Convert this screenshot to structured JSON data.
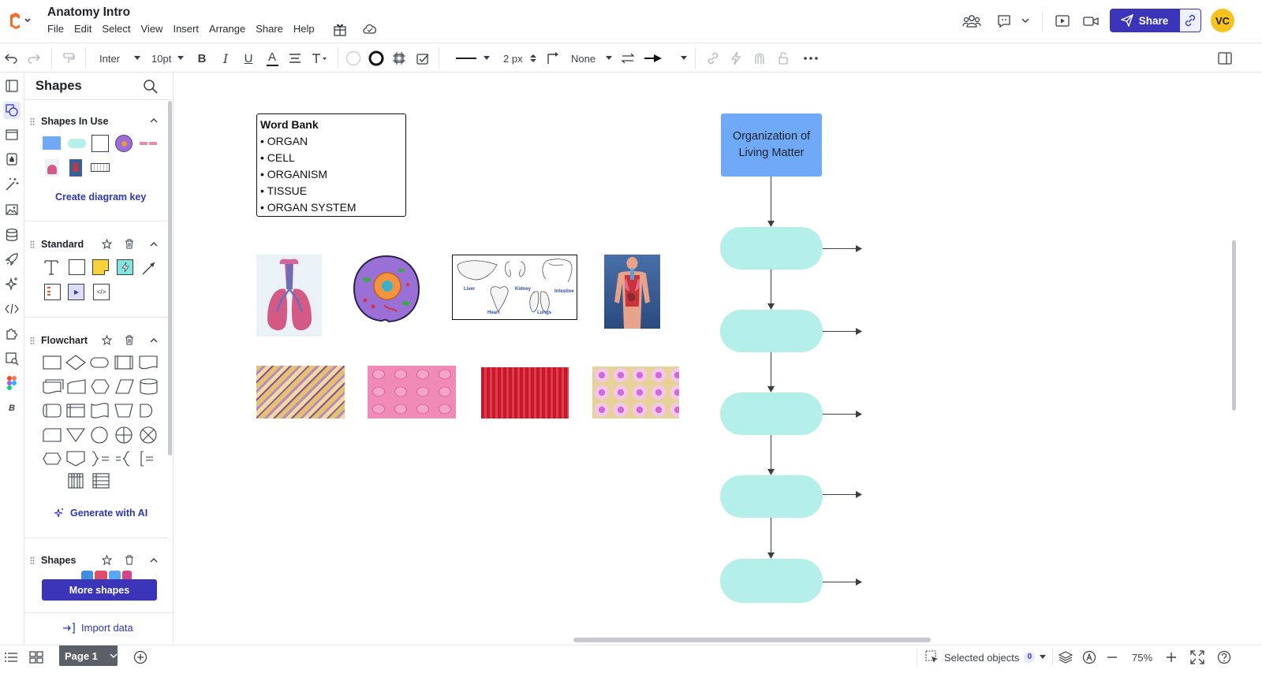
{
  "header": {
    "title": "Anatomy Intro",
    "menu": [
      "File",
      "Edit",
      "Select",
      "View",
      "Insert",
      "Arrange",
      "Share",
      "Help"
    ],
    "share_label": "Share",
    "avatar_initials": "VC"
  },
  "toolbar": {
    "font": "Inter",
    "font_size": "10pt",
    "line_width": "2 px",
    "arrow_start": "None"
  },
  "panel": {
    "title": "Shapes",
    "shapes_in_use": "Shapes In Use",
    "create_key": "Create diagram key",
    "standard": "Standard",
    "flowchart": "Flowchart",
    "generate_ai": "Generate with AI",
    "shapes_section": "Shapes",
    "more_shapes": "More shapes",
    "import_data": "Import data"
  },
  "canvas": {
    "word_bank": {
      "title": "Word Bank",
      "items": [
        "• ORGAN",
        "• CELL",
        "• ORGANISM",
        "• TISSUE",
        "• ORGAN SYSTEM"
      ]
    },
    "organ_labels": [
      "Liver",
      "Kidney",
      "Intestine",
      "Heart",
      "Lungs"
    ],
    "flow_title": "Organization of Living Matter"
  },
  "bottom": {
    "page_label": "Page 1",
    "selected_objects": "Selected objects",
    "selected_count": "0",
    "zoom": "75%"
  },
  "colors": {
    "accent": "#3a35b8",
    "flow_title_fill": "#6fa9f7",
    "pill_fill": "#b4f0e9"
  }
}
